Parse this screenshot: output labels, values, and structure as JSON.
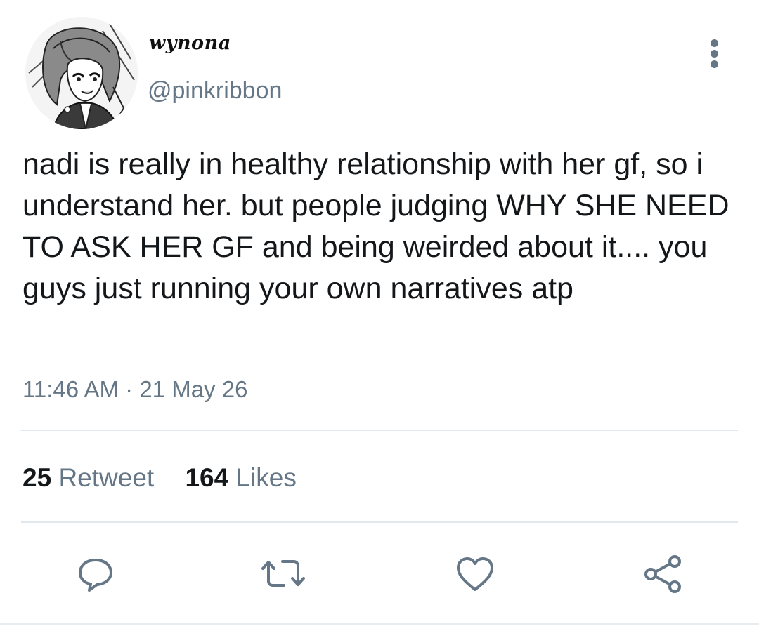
{
  "author": {
    "display_name": "wynona",
    "handle": "@pinkribbon",
    "avatar_icon": "anime-avatar-portrait"
  },
  "tweet": {
    "text": "nadi is really in healthy relationship with her gf, so i understand her. but people judging WHY SHE NEED TO ASK HER GF and being weirded about it.... you guys just running your own narratives atp",
    "time": "11:46 AM",
    "separator": "·",
    "date": "21 May 26"
  },
  "stats": {
    "retweet_count": "25",
    "retweet_label": "Retweet",
    "like_count": "164",
    "like_label": "Likes"
  },
  "actions": {
    "reply_icon": "speech-bubble-icon",
    "retweet_icon": "retweet-arrows-icon",
    "like_icon": "heart-icon",
    "share_icon": "share-nodes-icon"
  },
  "colors": {
    "text_primary": "#14171a",
    "text_secondary": "#657786",
    "divider": "#e1e8ed"
  }
}
